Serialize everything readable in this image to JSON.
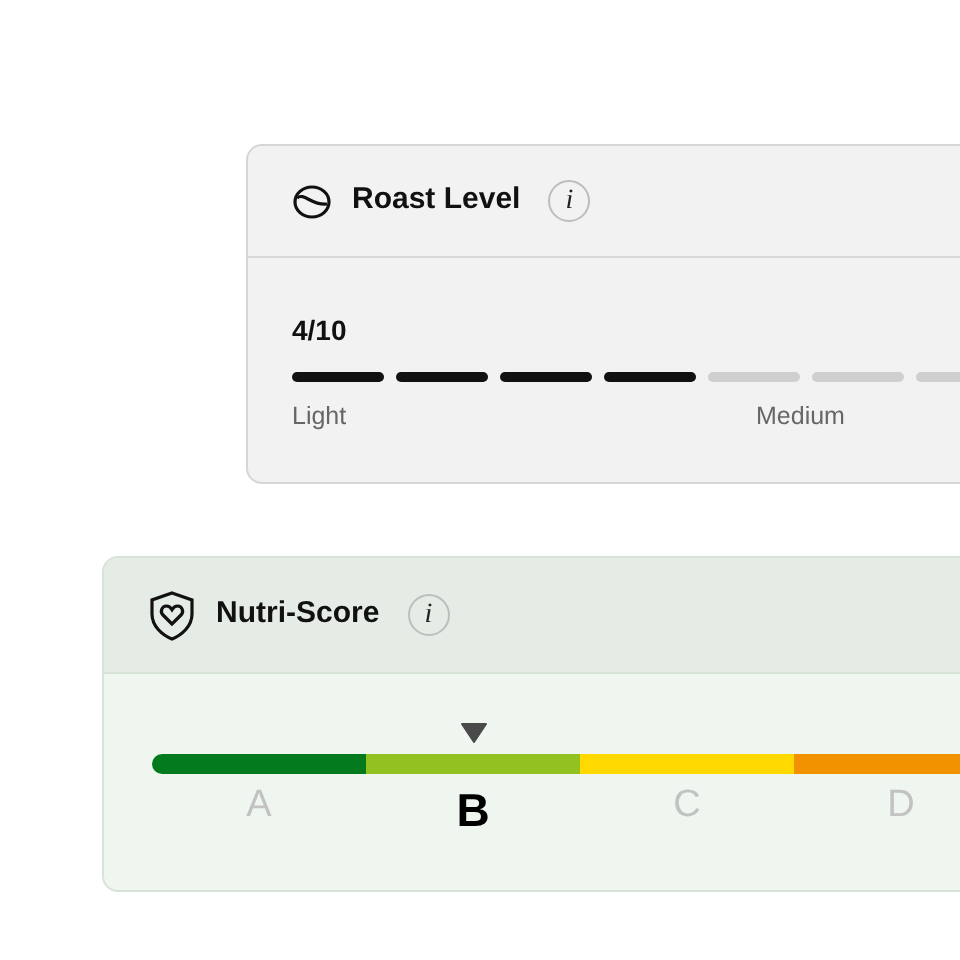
{
  "roast_level": {
    "title": "Roast Level",
    "info": "i",
    "reading": "4/10",
    "segments": [
      {
        "filled": true
      },
      {
        "filled": true
      },
      {
        "filled": true
      },
      {
        "filled": true
      },
      {
        "filled": false
      },
      {
        "filled": false
      },
      {
        "filled": false
      }
    ],
    "scale_labels": [
      "Light",
      "Medium"
    ]
  },
  "nutri_score": {
    "title": "Nutri-Score",
    "info": "i",
    "grades": [
      {
        "letter": "A",
        "color": "#037a1d",
        "selected": false
      },
      {
        "letter": "B",
        "color": "#93c11f",
        "selected": true
      },
      {
        "letter": "C",
        "color": "#ffd900",
        "selected": false
      },
      {
        "letter": "D",
        "color": "#f39200",
        "selected": false
      }
    ]
  }
}
